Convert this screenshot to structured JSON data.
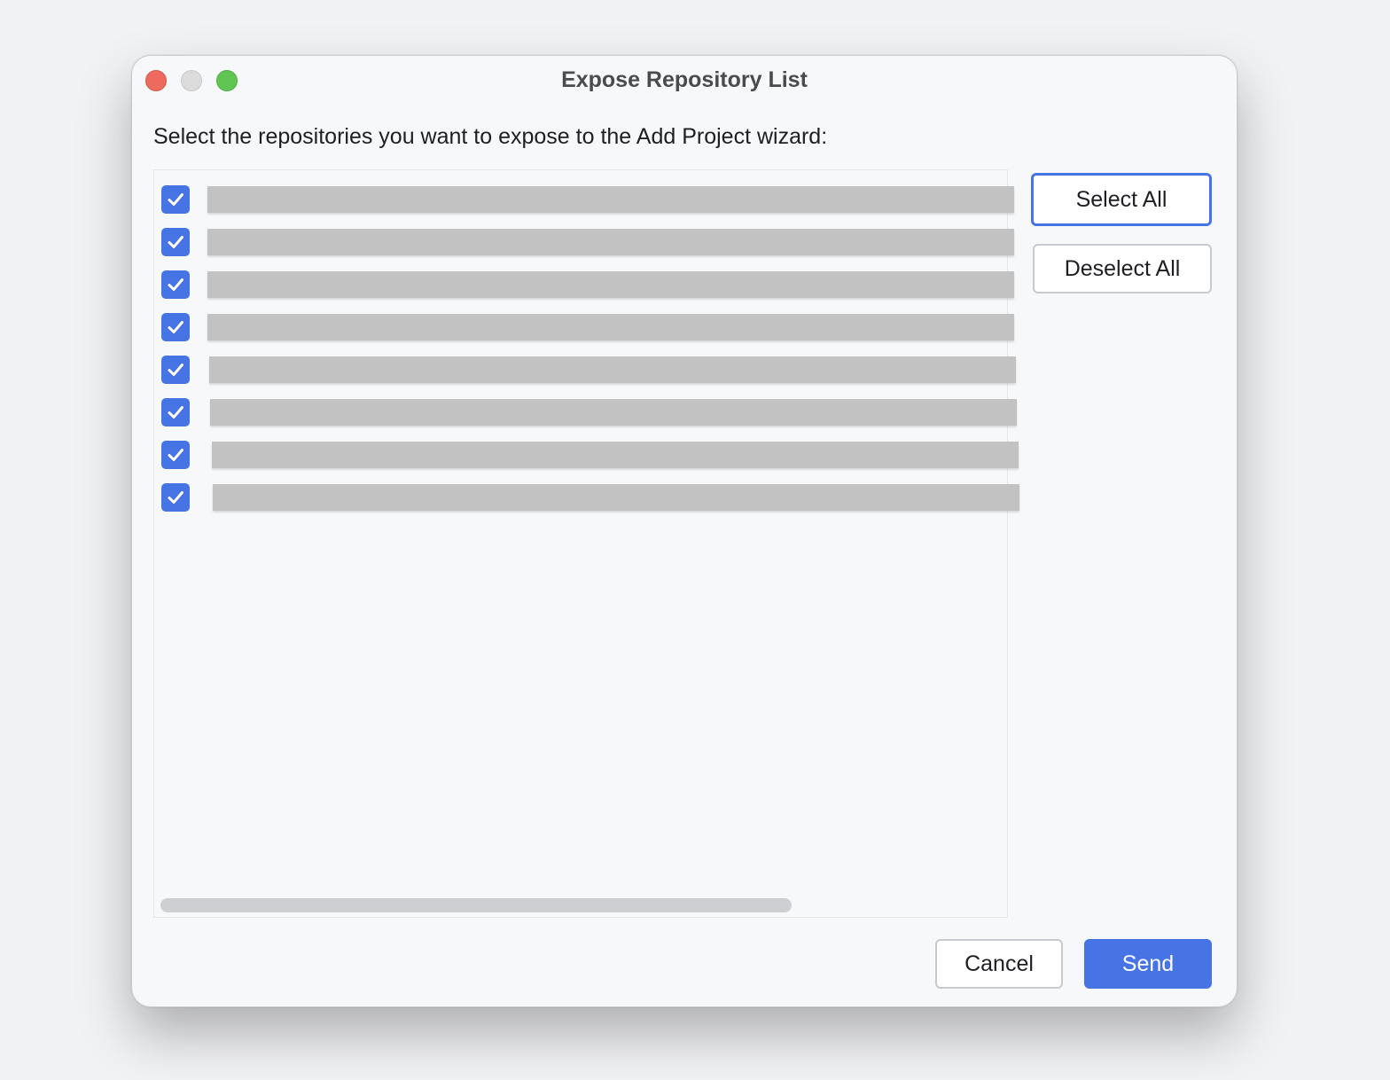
{
  "window": {
    "title": "Expose Repository List"
  },
  "dialog": {
    "instruction": "Select the repositories you want to expose to the Add Project wizard:",
    "repositories": [
      {
        "checked": true,
        "label_redacted": true
      },
      {
        "checked": true,
        "label_redacted": true
      },
      {
        "checked": true,
        "label_redacted": true
      },
      {
        "checked": true,
        "label_redacted": true
      },
      {
        "checked": true,
        "label_redacted": true
      },
      {
        "checked": true,
        "label_redacted": true
      },
      {
        "checked": true,
        "label_redacted": true
      },
      {
        "checked": true,
        "label_redacted": true
      }
    ],
    "select_all_label": "Select All",
    "deselect_all_label": "Deselect All",
    "cancel_label": "Cancel",
    "send_label": "Send"
  },
  "colors": {
    "accent": "#4674e4",
    "close": "#ec6a5e",
    "minimize": "#dcdcdc",
    "maximize": "#61c554",
    "redaction": "#c2c2c2"
  },
  "icons": {
    "checkbox": "checkmark-icon"
  }
}
